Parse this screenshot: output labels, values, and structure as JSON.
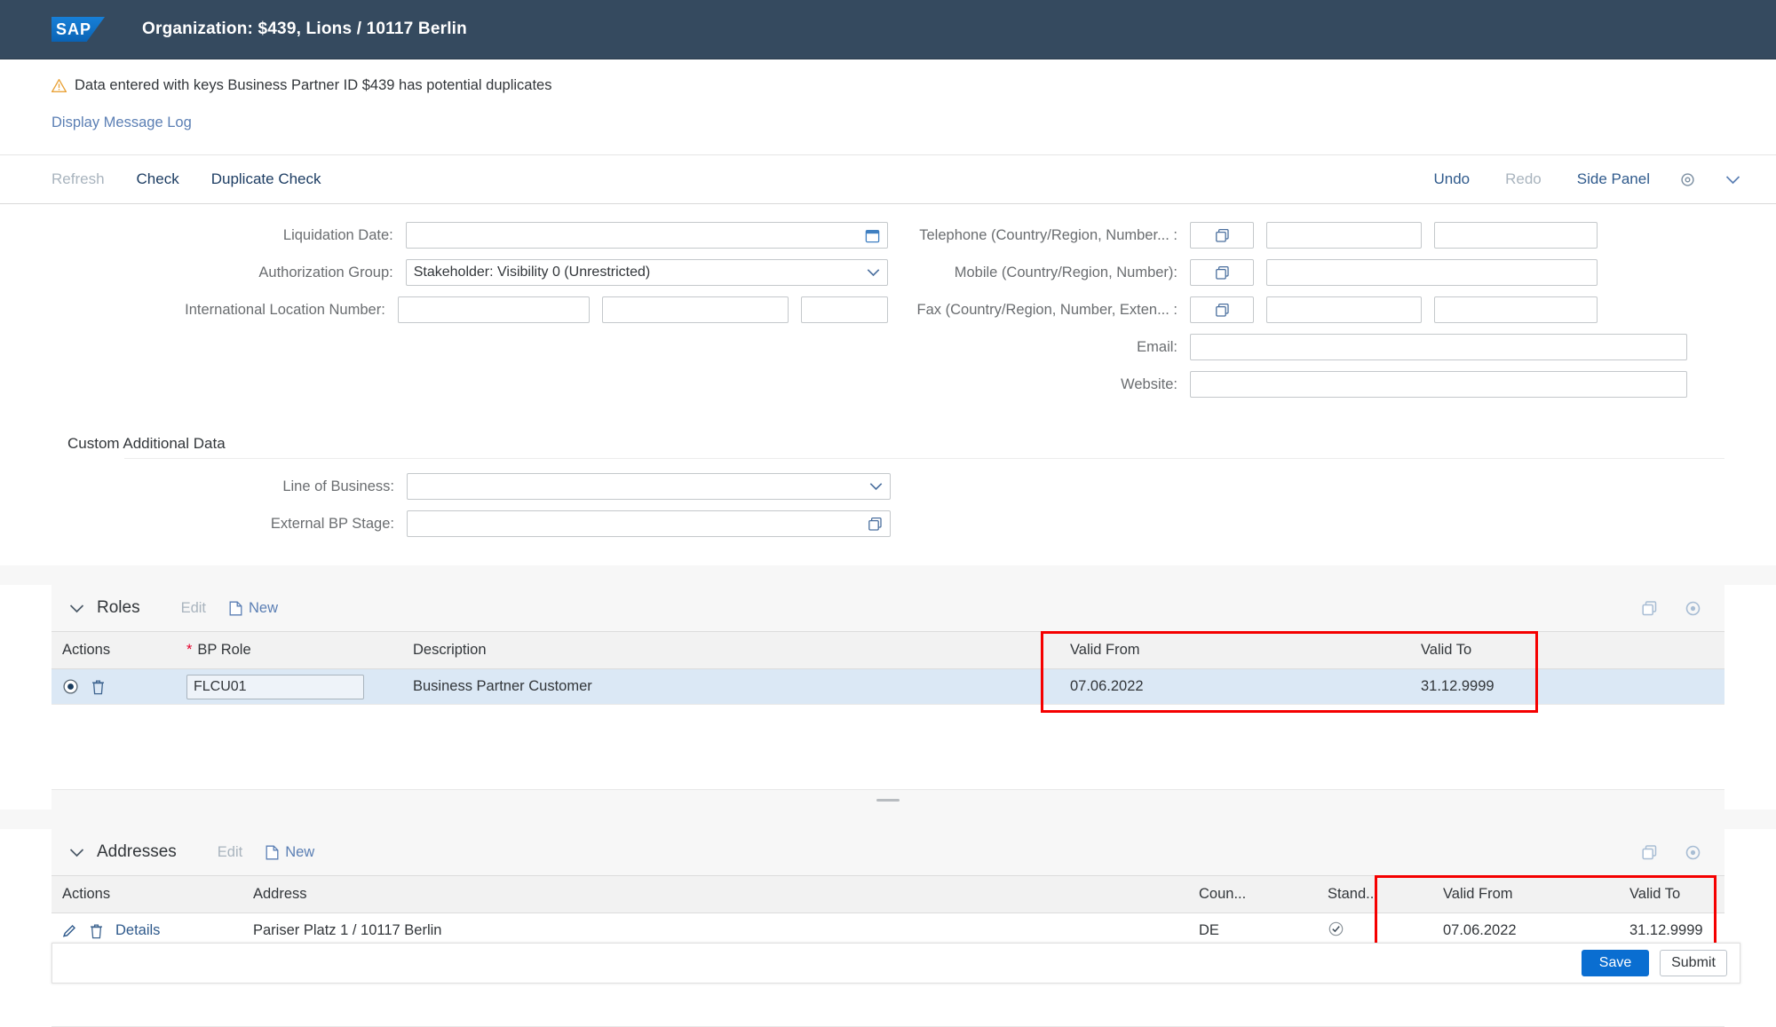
{
  "shell": {
    "logo_text": "SAP",
    "title": "Organization: $439, Lions / 10117 Berlin"
  },
  "message": {
    "warning_text": "Data entered with keys Business Partner ID $439 has potential duplicates",
    "log_link": "Display Message Log"
  },
  "toolbar": {
    "refresh": "Refresh",
    "check": "Check",
    "duplicate_check": "Duplicate Check",
    "undo": "Undo",
    "redo": "Redo",
    "side_panel": "Side Panel"
  },
  "form": {
    "left": [
      {
        "label": "Liquidation Date:",
        "value": "",
        "suffix": "calendar-icon"
      },
      {
        "label": "Authorization Group:",
        "value": "Stakeholder: Visibility 0 (Unrestricted)",
        "suffix": "chevron-down-icon"
      },
      {
        "label": "International Location Number:",
        "value": "",
        "suffix": ""
      }
    ],
    "right": [
      {
        "label": "Telephone (Country/Region, Number... :",
        "value": "",
        "suffix": "value-help-icon"
      },
      {
        "label": "Mobile (Country/Region, Number):",
        "value": "",
        "suffix": "value-help-icon"
      },
      {
        "label": "Fax (Country/Region, Number, Exten... :",
        "value": "",
        "suffix": "value-help-icon"
      },
      {
        "label": "Email:",
        "value": "",
        "suffix": ""
      },
      {
        "label": "Website:",
        "value": "",
        "suffix": ""
      }
    ],
    "custom_section_title": "Custom Additional Data",
    "custom": [
      {
        "label": "Line of Business:",
        "value": "",
        "suffix": "chevron-down-icon"
      },
      {
        "label": "External BP Stage:",
        "value": "",
        "suffix": "value-help-icon"
      }
    ]
  },
  "roles": {
    "title": "Roles",
    "edit_label": "Edit",
    "new_label": "New",
    "columns": [
      "Actions",
      "BP Role",
      "Description",
      "Valid From",
      "Valid To"
    ],
    "required_column": "BP Role",
    "rows": [
      {
        "bp_role": "FLCU01",
        "description": "Business Partner Customer",
        "valid_from": "07.06.2022",
        "valid_to": "31.12.9999"
      }
    ]
  },
  "addresses": {
    "title": "Addresses",
    "edit_label": "Edit",
    "new_label": "New",
    "columns": [
      "Actions",
      "Address",
      "Coun...",
      "Stand...",
      "Valid From",
      "Valid To"
    ],
    "rows": [
      {
        "details_label": "Details",
        "address": "Pariser Platz 1 / 10117 Berlin",
        "country": "DE",
        "standard": true,
        "valid_from": "07.06.2022",
        "valid_to": "31.12.9999"
      }
    ]
  },
  "footer": {
    "save_label": "Save",
    "submit_label": "Submit"
  },
  "colors": {
    "shell_bg": "#354a5f",
    "accent": "#0a6ed1",
    "highlight": "#f50000",
    "link": "#5b7fb4",
    "selected_row": "#dbe8f5"
  }
}
